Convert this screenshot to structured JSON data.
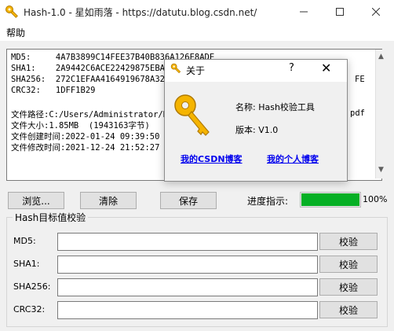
{
  "window": {
    "title": "Hash-1.0 - 星如雨落 - https://datutu.blog.csdn.net/"
  },
  "menu": {
    "help": "帮助"
  },
  "output": {
    "lines": [
      "MD5:     4A7B3899C14FEE37B40B836A126E8ADE",
      "SHA1:    2A9442C6ACE22429875EBABB",
      "SHA256:  272C1EFAA4164919678A32B6",
      "CRC32:   1DFF1B29",
      "",
      "文件路径:C:/Users/Administrator/D",
      "文件大小:1.85MB  (1943163字节)",
      "文件创建时间:2022-01-24 09:39:50",
      "文件修改时间:2021-12-24 21:52:27"
    ],
    "right_fragments": {
      "sha256_tail": "FE",
      "path_tail": "pdf"
    }
  },
  "buttons": {
    "browse": "浏览...",
    "clear": "清除",
    "save": "保存"
  },
  "progress": {
    "label": "进度指示:",
    "value": 100,
    "text": "100%"
  },
  "verify": {
    "group_title": "Hash目标值校验",
    "fields": [
      {
        "label": "MD5:",
        "value": "",
        "button": "校验"
      },
      {
        "label": "SHA1:",
        "value": "",
        "button": "校验"
      },
      {
        "label": "SHA256:",
        "value": "",
        "button": "校验"
      },
      {
        "label": "CRC32:",
        "value": "",
        "button": "校验"
      }
    ]
  },
  "about": {
    "title": "关于",
    "help": "?",
    "close": "✕",
    "name": "名称: Hash校验工具",
    "version": "版本: V1.0",
    "link_csdn": "我的CSDN博客",
    "link_personal": "我的个人博客"
  },
  "colors": {
    "accent_progress": "#06b025",
    "link": "#0000ee",
    "key_gold": "#f5b400"
  },
  "icons": {
    "app": "key-icon",
    "dialog": "key-icon",
    "large": "key-icon"
  }
}
